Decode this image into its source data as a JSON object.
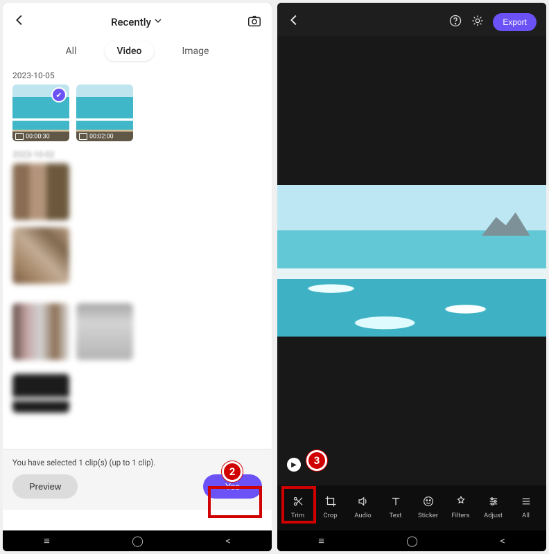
{
  "left": {
    "header_title": "Recently",
    "tabs": {
      "all": "All",
      "video": "Video",
      "image": "Image",
      "active": "video"
    },
    "sections": [
      {
        "date": "2023-10-05",
        "thumbs": [
          {
            "duration": "00:00:30",
            "selected": true,
            "style": "beach"
          },
          {
            "duration": "00:02:00",
            "selected": false,
            "style": "beach"
          }
        ]
      },
      {
        "date": "2023-10-02",
        "thumbs": [
          {
            "style": "pixelated"
          },
          {
            "style": "pixelated brown2"
          },
          {
            "style": "pixelated mix"
          },
          {
            "style": "pixelated light"
          }
        ]
      }
    ],
    "footer": {
      "message": "You have selected 1 clip(s) (up to 1 clip).",
      "preview_label": "Preview",
      "yes_label": "Yes"
    }
  },
  "right": {
    "export_label": "Export",
    "tools": [
      {
        "key": "trim",
        "label": "Trim"
      },
      {
        "key": "crop",
        "label": "Crop"
      },
      {
        "key": "audio",
        "label": "Audio"
      },
      {
        "key": "text",
        "label": "Text"
      },
      {
        "key": "sticker",
        "label": "Sticker"
      },
      {
        "key": "filters",
        "label": "Filters"
      },
      {
        "key": "adjust",
        "label": "Adjust"
      },
      {
        "key": "all",
        "label": "All"
      }
    ]
  },
  "steps": {
    "two": "2",
    "three": "3"
  }
}
